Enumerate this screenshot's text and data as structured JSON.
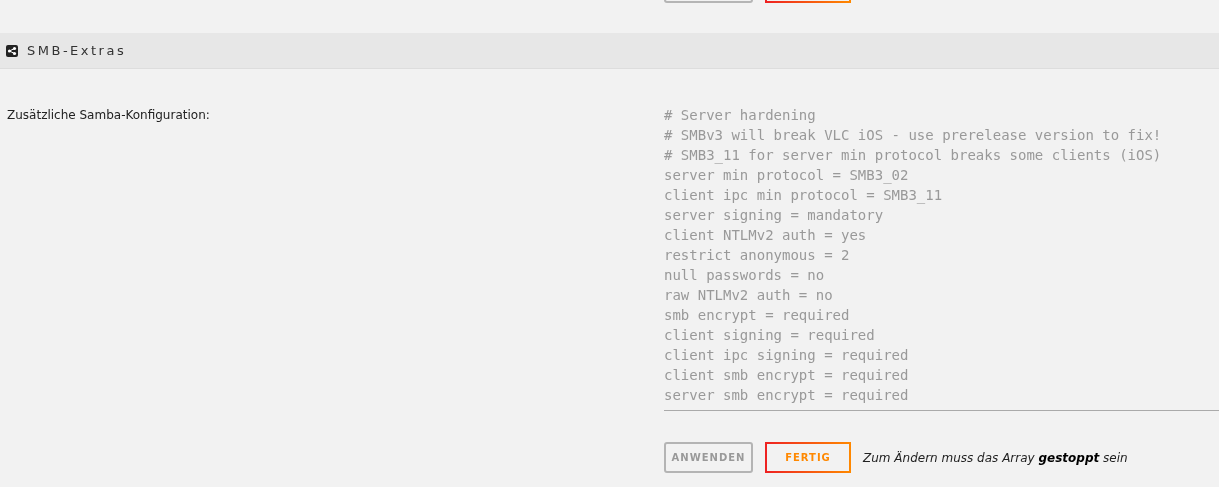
{
  "previous_section": {
    "buttons": [
      {
        "kind": "apply"
      },
      {
        "kind": "done"
      }
    ]
  },
  "section": {
    "title": "SMB-Extras"
  },
  "setting": {
    "label": "Zusätzliche Samba-Konfiguration:",
    "value": [
      "# Server hardening",
      "# SMBv3 will break VLC iOS - use prerelease version to fix!",
      "# SMB3_11 for server min protocol breaks some clients (iOS)",
      "server min protocol = SMB3_02",
      "client ipc min protocol = SMB3_11",
      "server signing = mandatory",
      "client NTLMv2 auth = yes",
      "restrict anonymous = 2",
      "null passwords = no",
      "raw NTLMv2 auth = no",
      "smb encrypt = required",
      "client signing = required",
      "client ipc signing = required",
      "client smb encrypt = required",
      "server smb encrypt = required"
    ]
  },
  "buttons": [
    {
      "kind": "apply",
      "label": "ANWENDEN"
    },
    {
      "kind": "done",
      "label": "FERTIG"
    }
  ],
  "note": "Zum Ändern muss das Array **gestoppt** sein"
}
